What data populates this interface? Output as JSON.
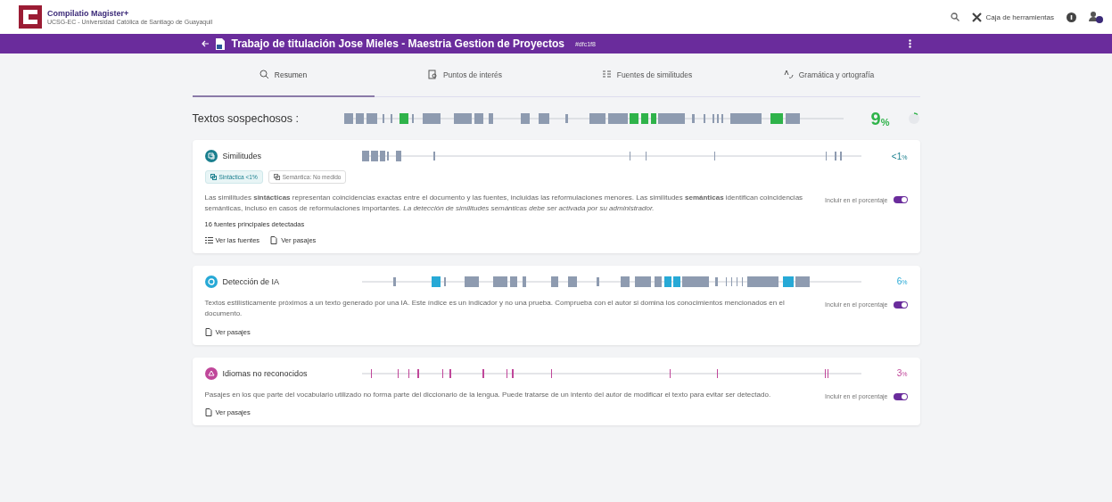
{
  "app": {
    "title": "Compilatio Magister+",
    "subtitle": "UCSG-EC - Universidad Católica de Santiago de Guayaquil",
    "toolbox": "Caja de herramientas"
  },
  "document": {
    "title": "Trabajo de titulación Jose Mieles - Maestria Gestion de Proyectos",
    "id": "#dfc1f8"
  },
  "tabs": [
    {
      "label": "Resumen",
      "selected": true
    },
    {
      "label": "Puntos de interés",
      "selected": false
    },
    {
      "label": "Fuentes de similitudes",
      "selected": false
    },
    {
      "label": "Gramática y ortografía",
      "selected": false
    }
  ],
  "summary": {
    "label": "Textos sospechosos :",
    "score": "9",
    "unit": "%",
    "color": "#2fb34a"
  },
  "sections": [
    {
      "title": "Similitudes",
      "color": "#1a7f8e",
      "score": "<1",
      "unit": "%",
      "chips": [
        "Sintáctica <1%",
        "Semántica: No medido"
      ],
      "description": "Las similitudes **sintácticas** representan coincidencias exactas entre el documento y las fuentes, incluidas las reformulaciones menores. Las similitudes **semánticas** identifican coincidencias semánticas, incluso en casos de reformulaciones importantes. *La detección de similitudes semánticas debe ser activada por su administrador.*",
      "toggle_label": "Incluir en el porcentaje",
      "on": true,
      "note": "16 fuentes principales detectadas",
      "links": [
        "Ver las fuentes",
        "Ver pasajes"
      ]
    },
    {
      "title": "Detección de IA",
      "color": "#27a9d6",
      "score": "6",
      "unit": "%",
      "description": "Textos estilísticamente próximos a un texto generado por una IA. Este índice es un indicador y no una prueba. Comprueba con el autor si domina los conocimientos mencionados en el documento.",
      "toggle_label": "Incluir en el porcentaje",
      "on": true,
      "links": [
        "Ver pasajes"
      ]
    },
    {
      "title": "Idiomas no reconocidos",
      "color": "#c0479a",
      "score": "3",
      "unit": "%",
      "description": "Pasajes en los que parte del vocabulario utilizado no forma parte del diccionario de la lengua. Puede tratarse de un intento del autor de modificar el texto para evitar ser detectado.",
      "toggle_label": "Incluir en el porcentaje",
      "on": true,
      "links": [
        "Ver pasajes"
      ]
    }
  ]
}
